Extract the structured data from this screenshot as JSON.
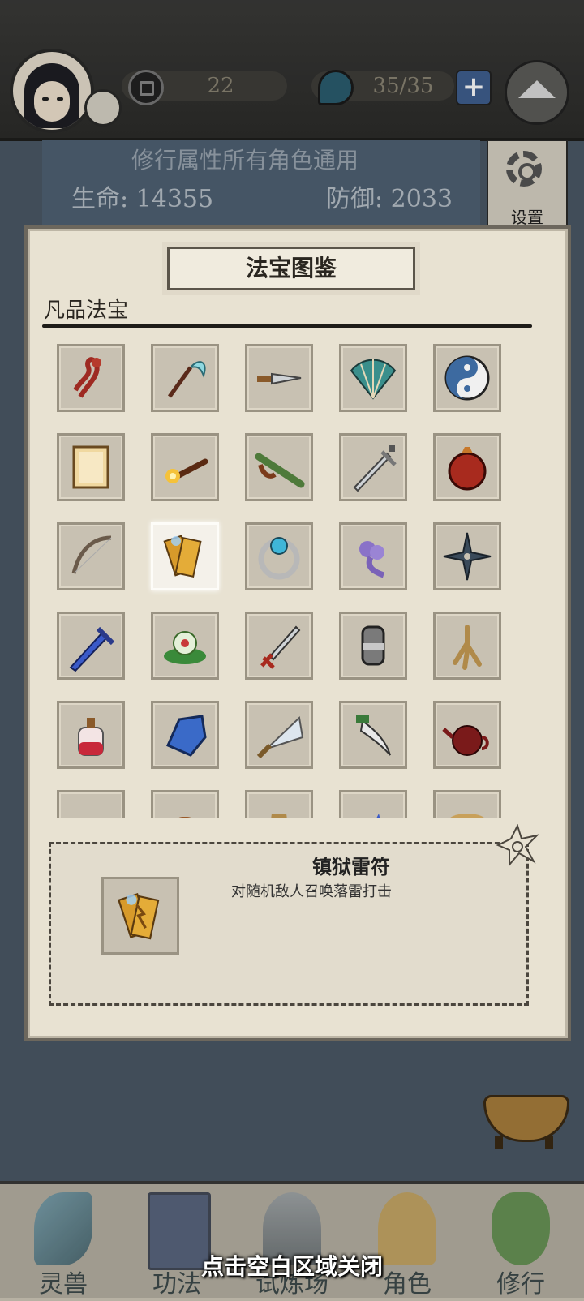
{
  "top_bar": {
    "coin_value": "22",
    "stamina_value": "35/35",
    "plus_label": "+"
  },
  "stats": {
    "note": "修行属性所有角色通用",
    "hp": "生命: 14355",
    "defense": "防御: 2033",
    "settings_label": "设置"
  },
  "dialog": {
    "title": "法宝图鉴",
    "section": "凡品法宝",
    "items": [
      {
        "icon": "red-sash-icon"
      },
      {
        "icon": "jade-whip-icon"
      },
      {
        "icon": "dagger-icon"
      },
      {
        "icon": "folding-fan-icon"
      },
      {
        "icon": "yin-yang-icon"
      },
      {
        "icon": "scroll-paper-icon"
      },
      {
        "icon": "torch-icon"
      },
      {
        "icon": "flute-icon"
      },
      {
        "icon": "sword-icon"
      },
      {
        "icon": "gourd-pouch-icon"
      },
      {
        "icon": "bow-icon"
      },
      {
        "icon": "thunder-talisman-icon",
        "selected": true
      },
      {
        "icon": "jade-ring-icon"
      },
      {
        "icon": "cloud-pendant-icon"
      },
      {
        "icon": "shuriken-icon"
      },
      {
        "icon": "blue-sword-icon"
      },
      {
        "icon": "lotus-icon"
      },
      {
        "icon": "red-dagger-icon"
      },
      {
        "icon": "gauntlet-icon"
      },
      {
        "icon": "ginseng-icon"
      },
      {
        "icon": "potion-bottle-icon"
      },
      {
        "icon": "blue-crystal-icon"
      },
      {
        "icon": "feather-fan-icon"
      },
      {
        "icon": "curved-knife-icon"
      },
      {
        "icon": "teapot-icon"
      },
      {
        "icon": "green-leaf-icon"
      },
      {
        "icon": "clay-jar-icon"
      },
      {
        "icon": "vase-icon"
      },
      {
        "icon": "blue-shard-icon"
      },
      {
        "icon": "mushroom-icon"
      }
    ],
    "detail": {
      "name": "镇狱雷符",
      "description": "对随机敌人召唤落雷打击",
      "icon": "thunder-talisman-icon"
    }
  },
  "bottom_nav": [
    {
      "label": "灵兽",
      "icon": "feather-icon"
    },
    {
      "label": "功法",
      "icon": "book-icon"
    },
    {
      "label": "试炼场",
      "icon": "mountain-icon"
    },
    {
      "label": "角色",
      "icon": "straw-hat-icon"
    },
    {
      "label": "修行",
      "icon": "gourd-icon"
    }
  ],
  "close_hint": "点击空白区域关闭",
  "colors": {
    "panel_bg": "#e8e2d2",
    "cell_bg": "#c8c1b2",
    "background_blue": "#4f6173",
    "accent_red": "#9e2a22",
    "accent_blue": "#3f5f8f"
  }
}
